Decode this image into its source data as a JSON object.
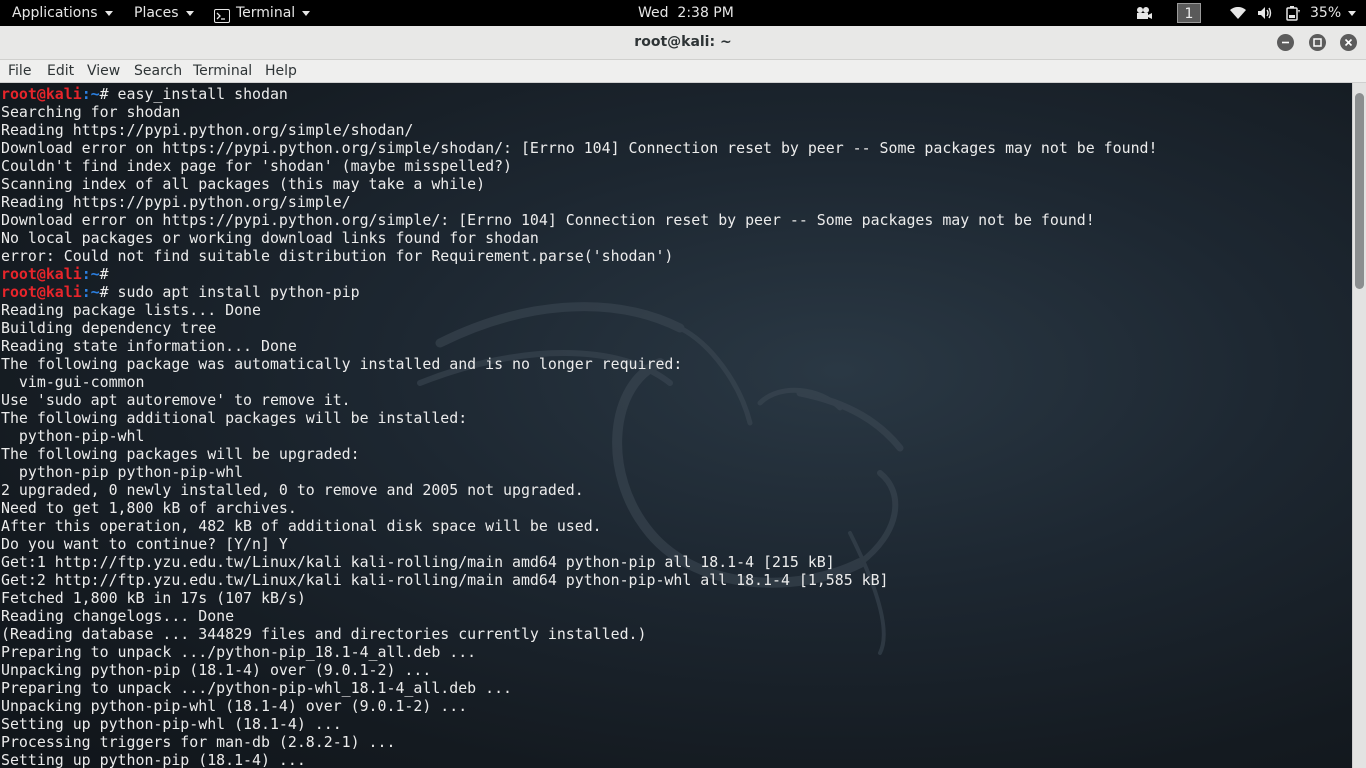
{
  "topbar": {
    "applications": "Applications",
    "places": "Places",
    "terminal": "Terminal",
    "clock": "Wed  2:38 PM",
    "workspace": "1",
    "battery": "35%"
  },
  "window": {
    "title": "root@kali: ~"
  },
  "menubar": {
    "items": [
      "File",
      "Edit",
      "View",
      "Search",
      "Terminal",
      "Help"
    ]
  },
  "prompt": {
    "user": "root@kali",
    "path": ":~",
    "symbol": "#"
  },
  "terminal_lines": [
    {
      "type": "cmd",
      "text": " easy_install shodan"
    },
    {
      "type": "out",
      "text": "Searching for shodan"
    },
    {
      "type": "out",
      "text": "Reading https://pypi.python.org/simple/shodan/"
    },
    {
      "type": "out",
      "text": "Download error on https://pypi.python.org/simple/shodan/: [Errno 104] Connection reset by peer -- Some packages may not be found!"
    },
    {
      "type": "out",
      "text": "Couldn't find index page for 'shodan' (maybe misspelled?)"
    },
    {
      "type": "out",
      "text": "Scanning index of all packages (this may take a while)"
    },
    {
      "type": "out",
      "text": "Reading https://pypi.python.org/simple/"
    },
    {
      "type": "out",
      "text": "Download error on https://pypi.python.org/simple/: [Errno 104] Connection reset by peer -- Some packages may not be found!"
    },
    {
      "type": "out",
      "text": "No local packages or working download links found for shodan"
    },
    {
      "type": "out",
      "text": "error: Could not find suitable distribution for Requirement.parse('shodan')"
    },
    {
      "type": "cmd",
      "text": ""
    },
    {
      "type": "cmd",
      "text": " sudo apt install python-pip"
    },
    {
      "type": "out",
      "text": "Reading package lists... Done"
    },
    {
      "type": "out",
      "text": "Building dependency tree"
    },
    {
      "type": "out",
      "text": "Reading state information... Done"
    },
    {
      "type": "out",
      "text": "The following package was automatically installed and is no longer required:"
    },
    {
      "type": "out",
      "text": "  vim-gui-common"
    },
    {
      "type": "out",
      "text": "Use 'sudo apt autoremove' to remove it."
    },
    {
      "type": "out",
      "text": "The following additional packages will be installed:"
    },
    {
      "type": "out",
      "text": "  python-pip-whl"
    },
    {
      "type": "out",
      "text": "The following packages will be upgraded:"
    },
    {
      "type": "out",
      "text": "  python-pip python-pip-whl"
    },
    {
      "type": "out",
      "text": "2 upgraded, 0 newly installed, 0 to remove and 2005 not upgraded."
    },
    {
      "type": "out",
      "text": "Need to get 1,800 kB of archives."
    },
    {
      "type": "out",
      "text": "After this operation, 482 kB of additional disk space will be used."
    },
    {
      "type": "out",
      "text": "Do you want to continue? [Y/n] Y"
    },
    {
      "type": "out",
      "text": "Get:1 http://ftp.yzu.edu.tw/Linux/kali kali-rolling/main amd64 python-pip all 18.1-4 [215 kB]"
    },
    {
      "type": "out",
      "text": "Get:2 http://ftp.yzu.edu.tw/Linux/kali kali-rolling/main amd64 python-pip-whl all 18.1-4 [1,585 kB]"
    },
    {
      "type": "out",
      "text": "Fetched 1,800 kB in 17s (107 kB/s)"
    },
    {
      "type": "out",
      "text": "Reading changelogs... Done"
    },
    {
      "type": "out",
      "text": "(Reading database ... 344829 files and directories currently installed.)"
    },
    {
      "type": "out",
      "text": "Preparing to unpack .../python-pip_18.1-4_all.deb ..."
    },
    {
      "type": "out",
      "text": "Unpacking python-pip (18.1-4) over (9.0.1-2) ..."
    },
    {
      "type": "out",
      "text": "Preparing to unpack .../python-pip-whl_18.1-4_all.deb ..."
    },
    {
      "type": "out",
      "text": "Unpacking python-pip-whl (18.1-4) over (9.0.1-2) ..."
    },
    {
      "type": "out",
      "text": "Setting up python-pip-whl (18.1-4) ..."
    },
    {
      "type": "out",
      "text": "Processing triggers for man-db (2.8.2-1) ..."
    },
    {
      "type": "out",
      "text": "Setting up python-pip (18.1-4) ..."
    }
  ],
  "colors": {
    "prompt_user": "#e8252b",
    "prompt_path": "#2b7fe0",
    "terminal_text": "#ececec",
    "panel_bg": "#000000"
  },
  "icons": {
    "topbar": [
      "terminal-icon",
      "video-camera-icon",
      "wifi-icon",
      "volume-icon",
      "battery-icon",
      "chevron-down-icon"
    ],
    "window": [
      "minimize-icon",
      "maximize-icon",
      "close-icon"
    ]
  }
}
